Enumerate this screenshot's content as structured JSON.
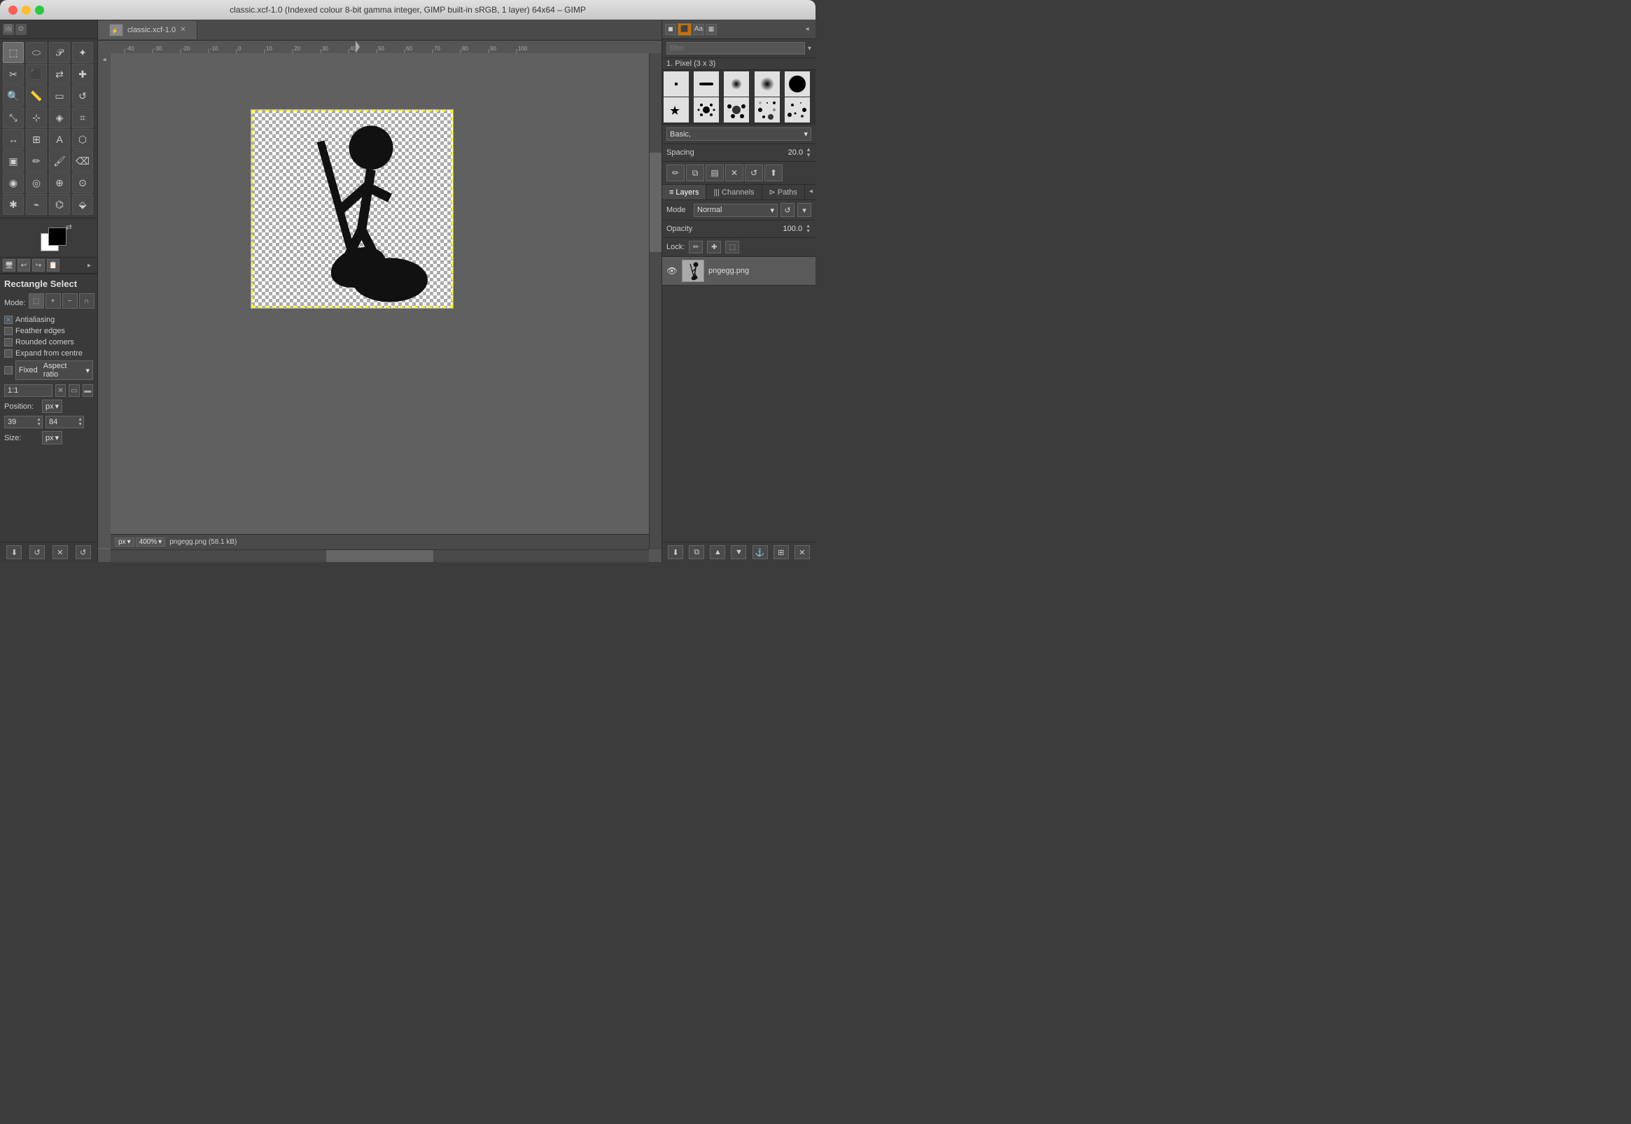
{
  "titlebar": {
    "title": "classic.xcf-1.0 (Indexed colour 8-bit gamma integer, GIMP built-in sRGB, 1 layer) 64x64 – GIMP",
    "close": "●",
    "minimize": "●",
    "maximize": "●"
  },
  "tabs": [
    {
      "label": "classic.xcf-1.0",
      "active": true
    }
  ],
  "toolbox": {
    "tools": [
      {
        "icon": "⬚",
        "name": "rectangle-select"
      },
      {
        "icon": "⬭",
        "name": "ellipse-select"
      },
      {
        "icon": "🔗",
        "name": "lasso"
      },
      {
        "icon": "✦",
        "name": "fuzzy-select"
      },
      {
        "icon": "✂",
        "name": "scissors"
      },
      {
        "icon": "⬛",
        "name": "foreground-select"
      },
      {
        "icon": "↔",
        "name": "align"
      },
      {
        "icon": "✚",
        "name": "move"
      },
      {
        "icon": "⤡",
        "name": "scale"
      },
      {
        "icon": "▭",
        "name": "crop"
      },
      {
        "icon": "↺",
        "name": "rotate"
      },
      {
        "icon": "⊹",
        "name": "perspective"
      },
      {
        "icon": "A",
        "name": "text"
      },
      {
        "icon": "⊕",
        "name": "bucket-fill"
      },
      {
        "icon": "✏",
        "name": "pencil"
      },
      {
        "icon": "🖌",
        "name": "paintbrush"
      },
      {
        "icon": "◈",
        "name": "airbrush"
      },
      {
        "icon": "⌫",
        "name": "eraser"
      },
      {
        "icon": "⬡",
        "name": "clone"
      },
      {
        "icon": "◉",
        "name": "heal"
      },
      {
        "icon": "⌗",
        "name": "smudge"
      },
      {
        "icon": "⌁",
        "name": "dodge-burn"
      },
      {
        "icon": "◎",
        "name": "paths"
      },
      {
        "icon": "⊙",
        "name": "color-picker"
      },
      {
        "icon": "⊞",
        "name": "zoom"
      },
      {
        "icon": "✋",
        "name": "measure"
      }
    ]
  },
  "tool_options": {
    "title": "Rectangle Select",
    "mode_label": "Mode:",
    "modes": [
      "new",
      "add",
      "subtract",
      "intersect"
    ],
    "antialiasing": {
      "label": "Antialiasing",
      "checked": true
    },
    "feather_edges": {
      "label": "Feather edges",
      "checked": false
    },
    "rounded_corners": {
      "label": "Rounded comers",
      "checked": false
    },
    "expand_from_centre": {
      "label": "Expand from centre",
      "checked": false
    },
    "fixed_aspect_ratio": {
      "label": "Fixed",
      "dropdown": "Aspect ratio",
      "checked": false
    },
    "ratio_value": "1:1",
    "position_label": "Position:",
    "position_unit": "px",
    "pos_x": "39",
    "pos_y": "84",
    "size_label": "Size:",
    "size_unit": "px"
  },
  "right_panel": {
    "filter_placeholder": "filter",
    "brush_title": "1. Pixel (3 x 3)",
    "brush_type": "Basic,",
    "spacing_label": "Spacing",
    "spacing_value": "20.0",
    "tabs": [
      "Layers",
      "Channels",
      "Paths"
    ],
    "active_tab": "Layers",
    "mode_label": "Mode",
    "mode_value": "Normal",
    "opacity_label": "Opacity",
    "opacity_value": "100.0",
    "lock_label": "Lock:",
    "layer_name": "pngegg.png"
  },
  "status_bar": {
    "unit": "px",
    "zoom": "400%",
    "filename": "pngegg.png (58.1 kB)"
  }
}
